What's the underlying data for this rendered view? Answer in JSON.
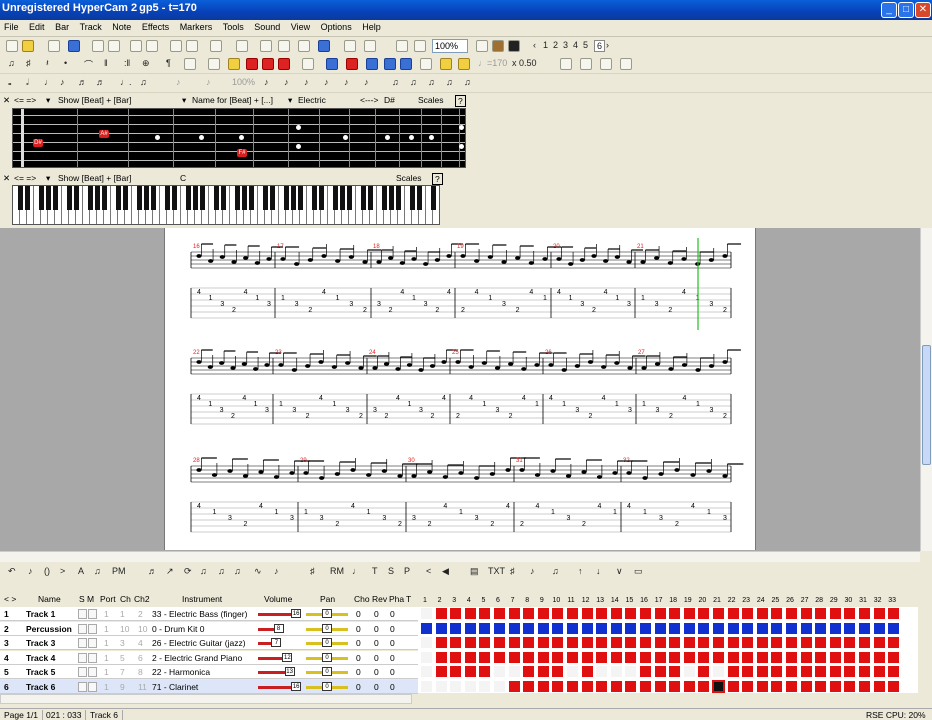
{
  "window": {
    "title": "Unregistered HyperCam 2",
    "title_tail": "gp5 - t=170",
    "min": "_",
    "max": "□",
    "close": "✕"
  },
  "menu": [
    "File",
    "Edit",
    "Bar",
    "Track",
    "Note",
    "Effects",
    "Markers",
    "Tools",
    "Sound",
    "View",
    "Options",
    "Help"
  ],
  "toolbar1": {
    "zoom": "100%",
    "pages": [
      "1",
      "2",
      "3",
      "4",
      "5",
      "6"
    ]
  },
  "toolbar3": {
    "percent": "100%",
    "tempo": "♩=170",
    "speed": "x 0.50"
  },
  "fretpanel": {
    "nav": "<= =>",
    "show": "Show [Beat] + [Bar]",
    "name_for": "Name for [Beat] + [...]",
    "instrument": "Electric",
    "range": "<--->",
    "key": "D#",
    "scales": "Scales",
    "help": "?",
    "marks": [
      "D#",
      "A#",
      "F#"
    ]
  },
  "keypanel": {
    "nav": "<= =>",
    "show": "Show [Beat] + [Bar]",
    "key": "C",
    "scales": "Scales",
    "help": "?"
  },
  "score": {
    "measures_row1": [
      "16",
      "17",
      "18",
      "19",
      "20",
      "21"
    ],
    "measures_row2": [
      "22",
      "23",
      "24",
      "25",
      "26",
      "27"
    ],
    "measures_row3": [
      "28",
      "29",
      "30",
      "31",
      "32"
    ]
  },
  "tracks": {
    "headers": {
      "nav": "< >",
      "name": "Name",
      "sm": "S M",
      "port": "Port",
      "ch": "Ch",
      "ch2": "Ch2",
      "instrument": "Instrument",
      "volume": "Volume",
      "pan": "Pan",
      "cho": "Cho",
      "rev": "Rev",
      "pha": "Pha",
      "t": "T"
    },
    "rows": [
      {
        "num": "1",
        "name": "Track 1",
        "port": "1",
        "ch": "1",
        "ch2": "2",
        "instrument": "33 - Electric Bass (finger)",
        "vol": "16",
        "cho": "0",
        "rev": "0",
        "pha": "0"
      },
      {
        "num": "2",
        "name": "Percussion",
        "port": "1",
        "ch": "10",
        "ch2": "10",
        "instrument": "0 - Drum Kit 0",
        "vol": "8",
        "cho": "0",
        "rev": "0",
        "pha": "0"
      },
      {
        "num": "3",
        "name": "Track 3",
        "port": "1",
        "ch": "3",
        "ch2": "4",
        "instrument": "26 - Electric Guitar (jazz)",
        "vol": "7",
        "cho": "0",
        "rev": "0",
        "pha": "0"
      },
      {
        "num": "4",
        "name": "Track 4",
        "port": "1",
        "ch": "5",
        "ch2": "6",
        "instrument": "2 - Electric Grand Piano",
        "vol": "12",
        "cho": "0",
        "rev": "0",
        "pha": "0"
      },
      {
        "num": "5",
        "name": "Track 5",
        "port": "1",
        "ch": "7",
        "ch2": "8",
        "instrument": "22 - Harmonica",
        "vol": "13",
        "cho": "0",
        "rev": "0",
        "pha": "0"
      },
      {
        "num": "6",
        "name": "Track 6",
        "port": "1",
        "ch": "9",
        "ch2": "11",
        "instrument": "71 - Clarinet",
        "vol": "16",
        "cho": "0",
        "rev": "0",
        "pha": "0"
      }
    ],
    "pan_value": "0",
    "bars": [
      "1",
      "2",
      "3",
      "4",
      "5",
      "6",
      "7",
      "8",
      "9",
      "10",
      "11",
      "12",
      "13",
      "14",
      "15",
      "16",
      "17",
      "18",
      "19",
      "20",
      "21",
      "22",
      "23",
      "24",
      "25",
      "26",
      "27",
      "28",
      "29",
      "30",
      "31",
      "32",
      "33"
    ]
  },
  "status": {
    "page": "Page 1/1",
    "position": "021 : 033",
    "track": "Track 6",
    "cpu": "RSE CPU: 20%"
  },
  "colors": {
    "filled": "#e01010",
    "percussion": "#1030d0",
    "empty": "#f4f4f4"
  }
}
